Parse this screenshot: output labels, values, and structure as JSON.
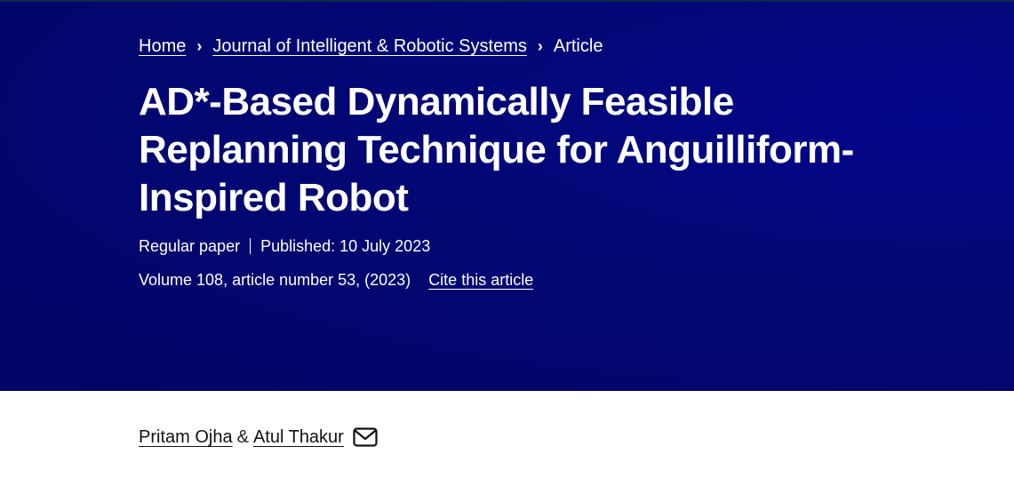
{
  "breadcrumb": {
    "items": [
      {
        "label": "Home"
      },
      {
        "label": "Journal of Intelligent & Robotic Systems"
      },
      {
        "label": "Article"
      }
    ]
  },
  "article": {
    "title": "AD*-Based Dynamically Feasible Replanning Technique for Anguilliform-Inspired Robot",
    "type": "Regular paper",
    "published": "Published: 10 July 2023",
    "volume_info": "Volume 108, article number 53, (2023)",
    "cite_label": "Cite this article"
  },
  "authors": {
    "list": [
      {
        "name": "Pritam Ojha"
      },
      {
        "name": "Atul Thakur"
      }
    ],
    "separator": "&",
    "contact_icon": "mail-icon"
  },
  "colors": {
    "hero_bg": "#020564",
    "hero_accent": "#02068a",
    "hero_text": "#ffffff",
    "body_text": "#111111"
  }
}
